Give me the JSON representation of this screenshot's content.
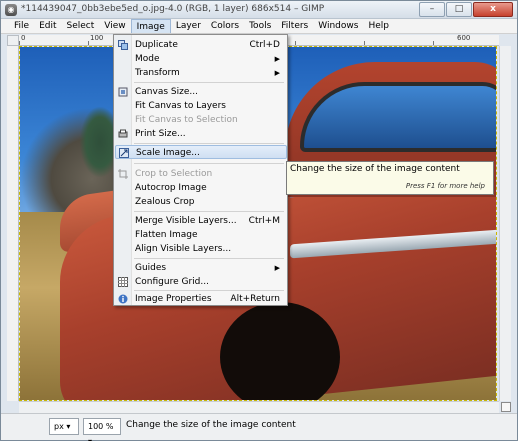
{
  "window": {
    "title": "*114439047_0bb3ebe5ed_o.jpg-4.0 (RGB, 1 layer) 686x514 – GIMP",
    "app_icon": "gimp-icon",
    "controls": {
      "minimize": "–",
      "maximize": "□",
      "close": "x"
    }
  },
  "menubar": {
    "items": [
      {
        "label": "File"
      },
      {
        "label": "Edit"
      },
      {
        "label": "Select"
      },
      {
        "label": "View"
      },
      {
        "label": "Image",
        "active": true
      },
      {
        "label": "Layer"
      },
      {
        "label": "Colors"
      },
      {
        "label": "Tools"
      },
      {
        "label": "Filters"
      },
      {
        "label": "Windows"
      },
      {
        "label": "Help"
      }
    ]
  },
  "ruler": {
    "top_numbers": [
      "0",
      "100",
      "600"
    ]
  },
  "image_menu": {
    "items": [
      {
        "label": "Duplicate",
        "shortcut": "Ctrl+D",
        "icon": "duplicate-icon"
      },
      {
        "label": "Mode",
        "submenu": true
      },
      {
        "label": "Transform",
        "submenu": true
      },
      {
        "label": "Canvas Size...",
        "icon": "canvas-size-icon"
      },
      {
        "label": "Fit Canvas to Layers"
      },
      {
        "label": "Fit Canvas to Selection",
        "disabled": true
      },
      {
        "label": "Print Size...",
        "icon": "print-size-icon"
      },
      {
        "label": "Scale Image...",
        "icon": "scale-image-icon",
        "highlighted": true
      },
      {
        "label": "Crop to Selection",
        "disabled": true,
        "icon": "crop-icon"
      },
      {
        "label": "Autocrop Image"
      },
      {
        "label": "Zealous Crop"
      },
      {
        "label": "Merge Visible Layers...",
        "shortcut": "Ctrl+M"
      },
      {
        "label": "Flatten Image"
      },
      {
        "label": "Align Visible Layers..."
      },
      {
        "label": "Guides",
        "submenu": true
      },
      {
        "label": "Configure Grid...",
        "icon": "grid-icon"
      },
      {
        "label": "Image Properties",
        "shortcut": "Alt+Return",
        "icon": "info-icon"
      }
    ]
  },
  "tooltip": {
    "text": "Change the size of the image content",
    "hint": "Press F1 for more help"
  },
  "statusbar": {
    "unit": "px",
    "zoom": "100 %",
    "message": "Change the size of the image content"
  }
}
